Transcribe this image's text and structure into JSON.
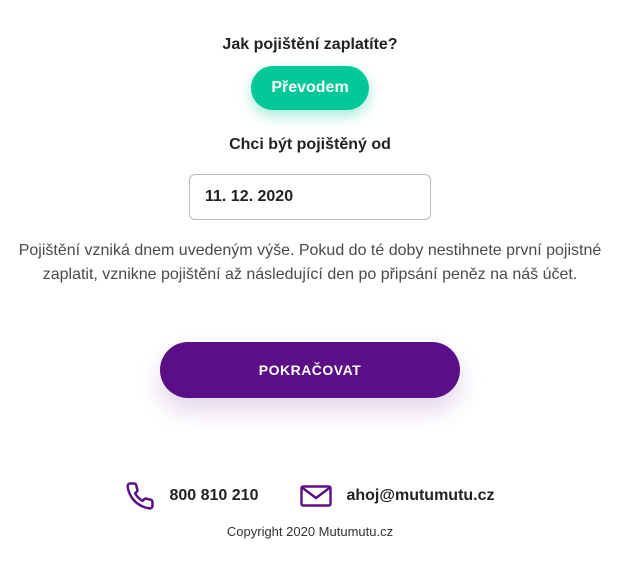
{
  "payment": {
    "heading": "Jak pojištění zaplatíte?",
    "method_button": "Převodem"
  },
  "start_date": {
    "heading": "Chci být pojištěný od",
    "value": "11. 12. 2020"
  },
  "info": {
    "text": "Pojištění vzniká dnem uvedeným výše. Pokud do té doby nestihnete první pojistné zaplatit, vznikne pojištění až následující den po připsání peněz na náš účet."
  },
  "actions": {
    "continue_label": "POKRAČOVAT"
  },
  "footer": {
    "phone": "800 810 210",
    "email": "ahoj@mutumutu.cz",
    "copyright": "Copyright 2020 Mutumutu.cz"
  },
  "colors": {
    "accent_green": "#00c896",
    "brand_purple": "#5b0f86"
  },
  "icons": {
    "phone": "phone-icon",
    "email": "envelope-icon"
  }
}
